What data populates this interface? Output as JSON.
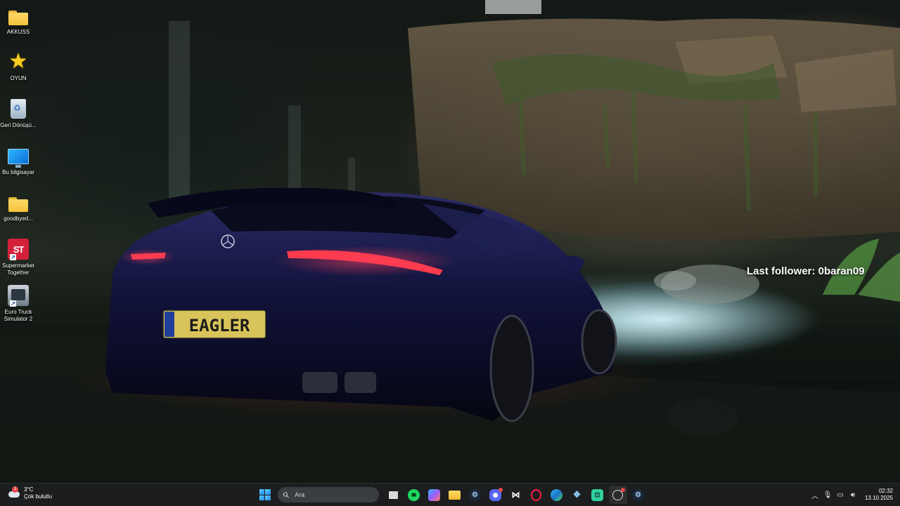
{
  "desktop": {
    "icons": [
      {
        "label": "AKKUSS",
        "icon": "folder-icon"
      },
      {
        "label": "OYUN",
        "icon": "star-icon"
      },
      {
        "label": "Geri Dönüşü...",
        "icon": "recycle-bin-icon"
      },
      {
        "label": "Bu bilgisayar",
        "icon": "computer-icon"
      },
      {
        "label": "goodbyed...",
        "icon": "folder-icon"
      },
      {
        "label": "Supermarket Together",
        "icon": "supermarket-together-icon",
        "glyph": "ST"
      },
      {
        "label": "Euro Truck Simulator 2",
        "icon": "euro-truck-simulator-icon"
      }
    ]
  },
  "wallpaper": {
    "plate_text": "EAGLER",
    "follower_text": "Last follower: 0baran09"
  },
  "taskbar": {
    "weather": {
      "temp": "3°C",
      "condition": "Çok bulutlu",
      "badge": "1"
    },
    "search": {
      "placeholder": "Ara"
    },
    "apps": [
      {
        "name": "task-view",
        "color": "#e8e8e8"
      },
      {
        "name": "spotify",
        "color": "#1ed760"
      },
      {
        "name": "copilot",
        "color": "#6f7bff"
      },
      {
        "name": "file-explorer",
        "color": "#f4c338"
      },
      {
        "name": "steam",
        "color": "#2a6fb0"
      },
      {
        "name": "discord",
        "color": "#5865f2"
      },
      {
        "name": "capcut",
        "color": "#ffffff"
      },
      {
        "name": "opera-gx",
        "color": "#ff1b4a"
      },
      {
        "name": "edge",
        "color": "#1fa2c8"
      },
      {
        "name": "network-app",
        "color": "#5aa9e6"
      },
      {
        "name": "xbox-app",
        "color": "#35d39a"
      },
      {
        "name": "obs-studio",
        "color": "#d0d0d0"
      },
      {
        "name": "steam-2",
        "color": "#6aa0d8"
      }
    ],
    "tray": {
      "time": "02:32",
      "date": "13.10.2025"
    }
  }
}
